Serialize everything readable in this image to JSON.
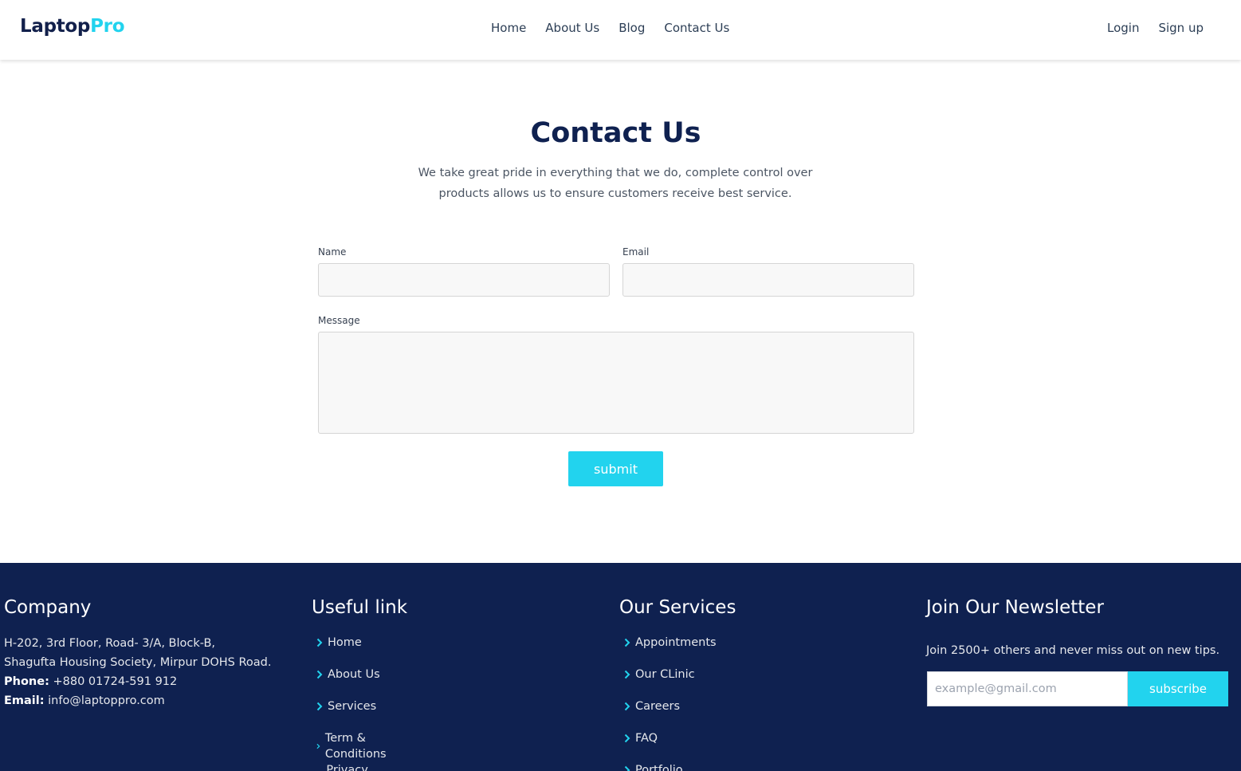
{
  "header": {
    "logo_part1": "Laptop",
    "logo_part2": "Pro",
    "nav": [
      "Home",
      "About Us",
      "Blog",
      "Contact Us"
    ],
    "auth": {
      "login": "Login",
      "signup": "Sign up"
    }
  },
  "main": {
    "title": "Contact Us",
    "description_line1": "We take great pride in everything that we do, complete control over",
    "description_line2": "products allows us to ensure customers receive best service.",
    "form": {
      "name_label": "Name",
      "name_value": "",
      "email_label": "Email",
      "email_value": "",
      "message_label": "Message",
      "message_value": "",
      "submit_label": "submit"
    }
  },
  "footer": {
    "company": {
      "title": "Company",
      "address_line1": "H-202, 3rd Floor, Road- 3/A, Block-B,",
      "address_line2": "Shagufta Housing Society, Mirpur DOHS Road.",
      "phone_label": "Phone:",
      "phone": "+880 01724-591 912",
      "email_label": "Email:",
      "email": "info@laptoppro.com"
    },
    "useful_links": {
      "title": "Useful link",
      "items": [
        "Home",
        "About Us",
        "Services",
        "Term & Conditions",
        "Privacy Police"
      ]
    },
    "services": {
      "title": "Our Services",
      "items": [
        "Appointments",
        "Our CLinic",
        "Careers",
        "FAQ",
        "Portfolio"
      ]
    },
    "newsletter": {
      "title": "Join Our Newsletter",
      "text": "Join 2500+ others and never miss out on new tips.",
      "placeholder": "example@gmail.com",
      "button": "subscribe"
    }
  },
  "colors": {
    "accent": "#22d3ee",
    "navy": "#0f2150",
    "field_bg": "#f8f8f8"
  },
  "icons": {
    "link_bullet": "chevron-right-icon"
  }
}
